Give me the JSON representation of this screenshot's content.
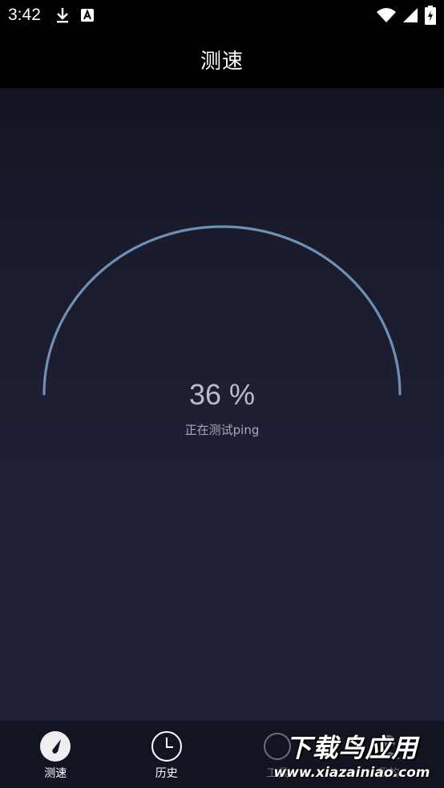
{
  "status_bar": {
    "time": "3:42",
    "left_icons": [
      "download-icon",
      "font-a-icon"
    ],
    "right_icons": [
      "wifi-icon",
      "signal-icon",
      "battery-charging-icon"
    ]
  },
  "app_bar": {
    "title": "测速"
  },
  "gauge": {
    "progress_label": "36 %",
    "progress_value": 36,
    "status": "正在测试ping",
    "arc_color": "#6f8fb5"
  },
  "bottom_nav": {
    "items": [
      {
        "label": "测速",
        "icon": "speedometer-icon",
        "active": true
      },
      {
        "label": "历史",
        "icon": "clock-icon",
        "active": false
      },
      {
        "label": "工具",
        "icon": "tools-icon",
        "active": false
      },
      {
        "label": "我的",
        "icon": "user-icon",
        "active": false
      }
    ]
  },
  "watermark": {
    "main": "下载鸟应用",
    "sub": "www.xiazainiao.com"
  },
  "colors": {
    "bar_background": "#000000",
    "main_background": "#1f1f35",
    "nav_background": "#131422",
    "text_primary": "#ffffff",
    "text_secondary": "#b9bccb"
  }
}
